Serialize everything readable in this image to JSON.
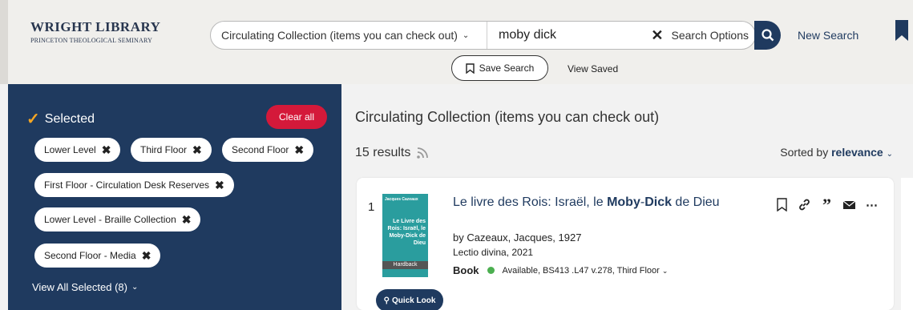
{
  "header": {
    "logo_main": "WRIGHT LIBRARY",
    "logo_sub": "PRINCETON THEOLOGICAL SEMINARY",
    "scope": "Circulating Collection (items you can check out)",
    "query": "moby dick",
    "search_options": "Search Options",
    "new_search": "New Search",
    "save_search": "Save Search",
    "view_saved": "View Saved"
  },
  "sidebar": {
    "title": "Selected",
    "clear_all": "Clear all",
    "chips": [
      "Lower Level",
      "Third Floor",
      "Second Floor",
      "First Floor - Circulation Desk Reserves",
      "Lower Level - Braille Collection",
      "Second Floor - Media"
    ],
    "view_all": "View All Selected (8)"
  },
  "main": {
    "title": "Circulating Collection (items you can check out)",
    "results_count": "15 results",
    "sorted_prefix": "Sorted by",
    "sorted_value": "relevance"
  },
  "result": {
    "number": "1",
    "cover_author": "Jacques Cazeaux",
    "cover_title": "Le Livre des Rois: Israël, le Moby-Dick de Dieu",
    "cover_format": "Hardback",
    "title_pre": "Le livre des Rois: Israël, le ",
    "title_b1": "Moby",
    "title_mid": "-",
    "title_b2": "Dick",
    "title_post": " de Dieu",
    "byline": "by Cazeaux, Jacques, 1927",
    "publisher": "Lectio divina, 2021",
    "format": "Book",
    "availability": "Available, BS413 .L47 v.278, Third Floor",
    "quick_look": "Quick Look"
  },
  "colors": {
    "navy": "#1f3a5f",
    "red": "#d4193a",
    "available": "#4caf50",
    "check": "#f5a623"
  }
}
